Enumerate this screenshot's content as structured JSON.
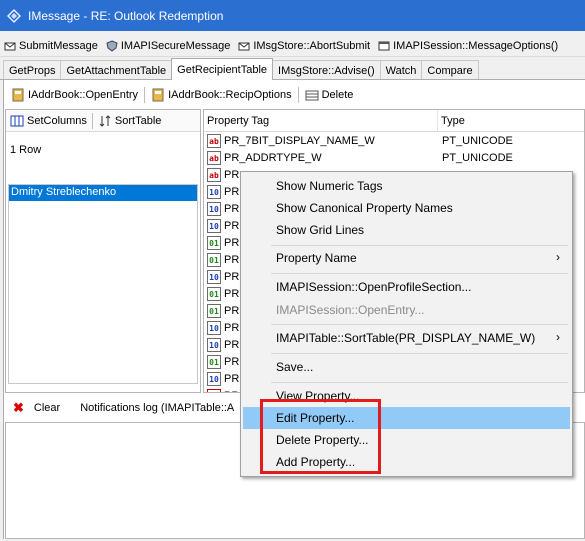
{
  "window": {
    "title": "IMessage - RE: Outlook Redemption"
  },
  "toolbar1": [
    "SubmitMessage",
    "IMAPISecureMessage",
    "IMsgStore::AbortSubmit",
    "IMAPISession::MessageOptions()"
  ],
  "tabs": [
    {
      "label": "GetProps",
      "active": false
    },
    {
      "label": "GetAttachmentTable",
      "active": false
    },
    {
      "label": "GetRecipientTable",
      "active": true
    },
    {
      "label": "IMsgStore::Advise()",
      "active": false
    },
    {
      "label": "Watch",
      "active": false
    },
    {
      "label": "Compare",
      "active": false
    }
  ],
  "toolbar2": [
    "IAddrBook::OpenEntry",
    "IAddrBook::RecipOptions",
    "Delete"
  ],
  "left_pane": {
    "set_columns": "SetColumns",
    "sort_table": "SortTable",
    "row_count": "1 Row",
    "items": [
      "Dmitry Streblechenko"
    ]
  },
  "grid": {
    "headers": {
      "tag": "Property Tag",
      "type": "Type"
    },
    "rows": [
      {
        "icon": "ab",
        "kind": "str",
        "tag": "PR_7BIT_DISPLAY_NAME_W",
        "type": "PT_UNICODE"
      },
      {
        "icon": "ab",
        "kind": "str",
        "tag": "PR_ADDRTYPE_W",
        "type": "PT_UNICODE"
      },
      {
        "icon": "ab",
        "kind": "str",
        "tag": "PR",
        "type": ""
      },
      {
        "icon": "10",
        "kind": "num",
        "tag": "PR",
        "type": ""
      },
      {
        "icon": "10",
        "kind": "num",
        "tag": "PR",
        "type": ""
      },
      {
        "icon": "10",
        "kind": "num",
        "tag": "PR",
        "type": ""
      },
      {
        "icon": "01",
        "kind": "bin",
        "tag": "PR",
        "type": ""
      },
      {
        "icon": "01",
        "kind": "bin",
        "tag": "PR",
        "type": ""
      },
      {
        "icon": "10",
        "kind": "num",
        "tag": "PR",
        "type": ""
      },
      {
        "icon": "01",
        "kind": "bin",
        "tag": "PR",
        "type": ""
      },
      {
        "icon": "01",
        "kind": "bin",
        "tag": "PR",
        "type": ""
      },
      {
        "icon": "10",
        "kind": "num",
        "tag": "PR",
        "type": ""
      },
      {
        "icon": "10",
        "kind": "num",
        "tag": "PR",
        "type": ""
      },
      {
        "icon": "01",
        "kind": "bin",
        "tag": "PR",
        "type": ""
      },
      {
        "icon": "10",
        "kind": "num",
        "tag": "PR",
        "type": ""
      },
      {
        "icon": "=?",
        "kind": "ent",
        "tag": "PR",
        "type": ""
      }
    ]
  },
  "notifications": {
    "clear_label": "Clear",
    "log_label": "Notifications log (IMAPITable::A"
  },
  "context_menu": {
    "items": [
      {
        "label": "Show Numeric Tags",
        "submenu": false,
        "disabled": false,
        "highlighted": false
      },
      {
        "label": "Show Canonical Property Names",
        "submenu": false,
        "disabled": false,
        "highlighted": false
      },
      {
        "label": "Show Grid Lines",
        "submenu": false,
        "disabled": false,
        "highlighted": false
      },
      {
        "label": "Property Name",
        "submenu": true,
        "disabled": false,
        "highlighted": false
      },
      {
        "label": "IMAPISession::OpenProfileSection...",
        "submenu": false,
        "disabled": false,
        "highlighted": false
      },
      {
        "label": "IMAPISession::OpenEntry...",
        "submenu": false,
        "disabled": true,
        "highlighted": false
      },
      {
        "label": "IMAPITable::SortTable(PR_DISPLAY_NAME_W)",
        "submenu": true,
        "disabled": false,
        "highlighted": false
      },
      {
        "label": "Save...",
        "submenu": false,
        "disabled": false,
        "highlighted": false
      },
      {
        "label": "View Property...",
        "submenu": false,
        "disabled": false,
        "highlighted": false
      },
      {
        "label": "Edit Property...",
        "submenu": false,
        "disabled": false,
        "highlighted": true
      },
      {
        "label": "Delete Property...",
        "submenu": false,
        "disabled": false,
        "highlighted": false
      },
      {
        "label": "Add Property...",
        "submenu": false,
        "disabled": false,
        "highlighted": false
      }
    ]
  },
  "colors": {
    "titlebar": "#2b6fd0",
    "selection": "#0078d7",
    "menu_highlight": "#91c9f7",
    "annotation_box": "#e21b1b"
  },
  "icons": {
    "app": "mail-envelope-icon",
    "clear": "delete-x-icon",
    "submenu": "chevron-right-icon"
  }
}
